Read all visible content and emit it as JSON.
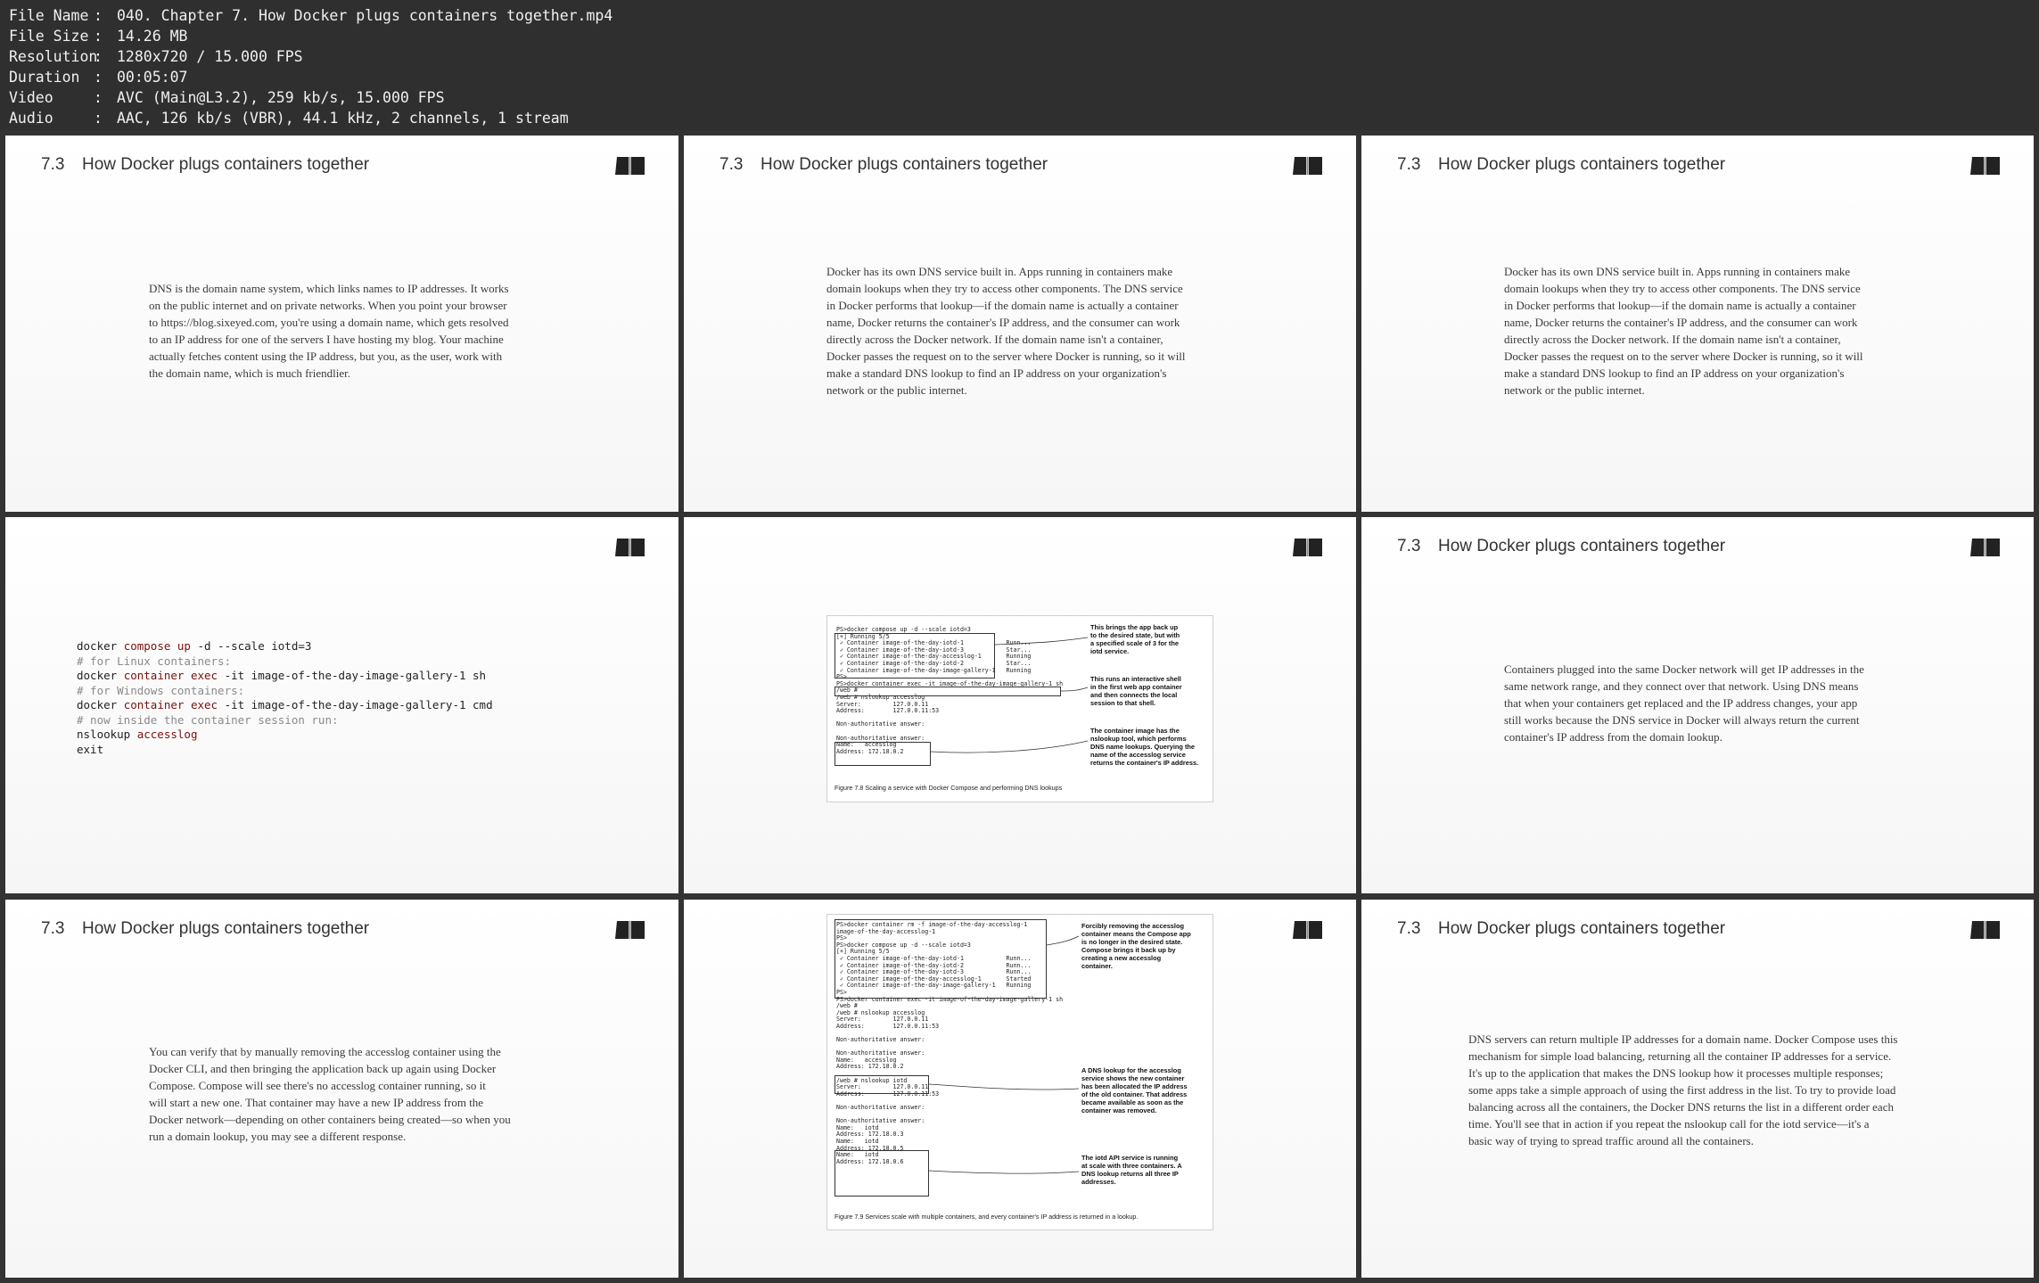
{
  "metadata": [
    {
      "key": "File Name",
      "value": "040. Chapter 7. How Docker plugs containers together.mp4"
    },
    {
      "key": "File Size",
      "value": "14.26 MB"
    },
    {
      "key": "Resolution",
      "value": "1280x720 / 15.000 FPS"
    },
    {
      "key": "Duration",
      "value": "00:05:07"
    },
    {
      "key": "Video",
      "value": "AVC (Main@L3.2), 259 kb/s, 15.000 FPS"
    },
    {
      "key": "Audio",
      "value": "AAC, 126 kb/s (VBR), 44.1 kHz, 2 channels, 1 stream"
    }
  ],
  "section": {
    "number": "7.3",
    "title": "How Docker plugs containers together"
  },
  "icon": "book-icon",
  "tiles": {
    "t1": {
      "text": "DNS is the domain name system, which links names to IP addresses. It works\non the public internet and on private networks. When you point your browser\nto https://blog.sixeyed.com, you're using a domain name, which gets resolved\nto an IP address for one of the servers I have hosting my blog. Your machine\nactually fetches content using the IP address, but you, as the user, work with\nthe domain name, which is much friendlier."
    },
    "t2": {
      "text": "Docker has its own DNS service built in. Apps running in containers make\ndomain lookups when they try to access other components. The DNS service\nin Docker performs that lookup—if the domain name is actually a container\nname, Docker returns the container's IP address, and the consumer can work\ndirectly across the Docker network. If the domain name isn't a container,\nDocker passes the request on to the server where Docker is running, so it will\nmake a standard DNS lookup to find an IP address on your organization's\nnetwork or the public internet."
    },
    "t3": {
      "text": "Docker has its own DNS service built in. Apps running in containers make\ndomain lookups when they try to access other components. The DNS service\nin Docker performs that lookup—if the domain name is actually a container\nname, Docker returns the container's IP address, and the consumer can work\ndirectly across the Docker network. If the domain name isn't a container,\nDocker passes the request on to the server where Docker is running, so it will\nmake a standard DNS lookup to find an IP address on your organization's\nnetwork or the public internet."
    },
    "t4": {
      "code": [
        {
          "t": "docker ",
          "kw": "compose up",
          "rest": " -d --scale iotd=3"
        },
        {
          "cm": "# for Linux containers:"
        },
        {
          "t": "docker ",
          "kw": "container exec",
          "rest": " -it image-of-the-day-image-gallery-1 sh"
        },
        {
          "cm": "# for Windows containers:"
        },
        {
          "t": "docker ",
          "kw": "container exec",
          "rest": " -it image-of-the-day-image-gallery-1 cmd"
        },
        {
          "cm": "# now inside the container session run:"
        },
        {
          "t": "nslookup ",
          "kw": "accesslog",
          "rest": ""
        },
        {
          "t": "exit",
          "kw": "",
          "rest": ""
        }
      ]
    },
    "t5": {
      "term": "PS>docker compose up -d --scale iotd=3\n[+] Running 5/5\n ✓ Container image-of-the-day-iotd-1            Runn...\n ✓ Container image-of-the-day-iotd-3            Star...\n ✓ Container image-of-the-day-accesslog-1       Running\n ✓ Container image-of-the-day-iotd-2            Star...\n ✓ Container image-of-the-day-image-gallery-1   Running\nPS>\nPS>docker container exec -it image-of-the-day-image-gallery-1 sh\n/web #\n/web # nslookup accesslog\nServer:         127.0.0.11\nAddress:        127.0.0.11:53\n\nNon-authoritative answer:\n\nNon-authoritative answer:\nName:   accesslog\nAddress: 172.18.0.2",
      "callouts": [
        "This brings the app back up\nto the desired state, but with\na specified scale of 3 for the\niotd service.",
        "This runs an interactive shell\nin the first web app container\nand then connects the local\nsession to that shell.",
        "The container image has the\nnslookup tool, which performs\nDNS name lookups. Querying the\nname of the accesslog service\nreturns the container's IP address."
      ],
      "caption": "Figure 7.8   Scaling a service with Docker Compose and performing DNS lookups"
    },
    "t6": {
      "text": "Containers plugged into the same Docker network will get IP addresses in the\nsame network range, and they connect over that network. Using DNS means\nthat when your containers get replaced and the IP address changes, your app\nstill works because the DNS service in Docker will always return the current\ncontainer's IP address from the domain lookup."
    },
    "t7": {
      "text": "You can verify that by manually removing the accesslog container using the\nDocker CLI, and then bringing the application back up again using Docker\nCompose. Compose will see there's no accesslog container running, so it\nwill start a new one. That container may have a new IP address from the\nDocker network—depending on other containers being created—so when you\nrun a domain lookup, you may see a different response."
    },
    "t8": {
      "term": "PS>docker container rm -f image-of-the-day-accesslog-1\nimage-of-the-day-accesslog-1\nPS>\nPS>docker compose up -d --scale iotd=3\n[+] Running 5/5\n ✓ Container image-of-the-day-iotd-1            Runn...\n ✓ Container image-of-the-day-iotd-2            Runn...\n ✓ Container image-of-the-day-iotd-3            Runn...\n ✓ Container image-of-the-day-accesslog-1       Started\n ✓ Container image-of-the-day-image-gallery-1   Running\nPS>\nPS>docker container exec -it image-of-the-day-image-gallery-1 sh\n/web #\n/web # nslookup accesslog\nServer:         127.0.0.11\nAddress:        127.0.0.11:53\n\nNon-authoritative answer:\n\nNon-authoritative answer:\nName:   accesslog\nAddress: 172.18.0.2\n\n/web # nslookup iotd\nServer:         127.0.0.11\nAddress:        127.0.0.11:53\n\nNon-authoritative answer:\n\nNon-authoritative answer:\nName:   iotd\nAddress: 172.18.0.3\nName:   iotd\nAddress: 172.18.0.5\nName:   iotd\nAddress: 172.18.0.6",
      "callouts": [
        "Forcibly removing the accesslog\ncontainer means the Compose app\nis no longer in the desired state.\nCompose brings it back up by\ncreating a new accesslog\ncontainer.",
        "A DNS lookup for the accesslog\nservice shows the new container\nhas been allocated the IP address\nof the old container. That address\nbecame available as soon as the\ncontainer was removed.",
        "The iotd API service is running\nat scale with three containers. A\nDNS lookup returns all three IP\naddresses."
      ],
      "caption": "Figure 7.9   Services scale with multiple containers, and every container's IP address is returned in a lookup."
    },
    "t9": {
      "text": "DNS servers can return multiple IP addresses for a domain name. Docker Compose uses this\nmechanism for simple load balancing, returning all the container IP addresses for a service.\nIt's up to the application that makes the DNS lookup how it processes multiple responses;\nsome apps take a simple approach of using the first address in the list. To try to provide load\nbalancing across all the containers, the Docker DNS returns the list in a different order each\ntime. You'll see that in action if you repeat the nslookup call for the iotd service—it's a\nbasic way of trying to spread traffic around all the containers."
    }
  }
}
